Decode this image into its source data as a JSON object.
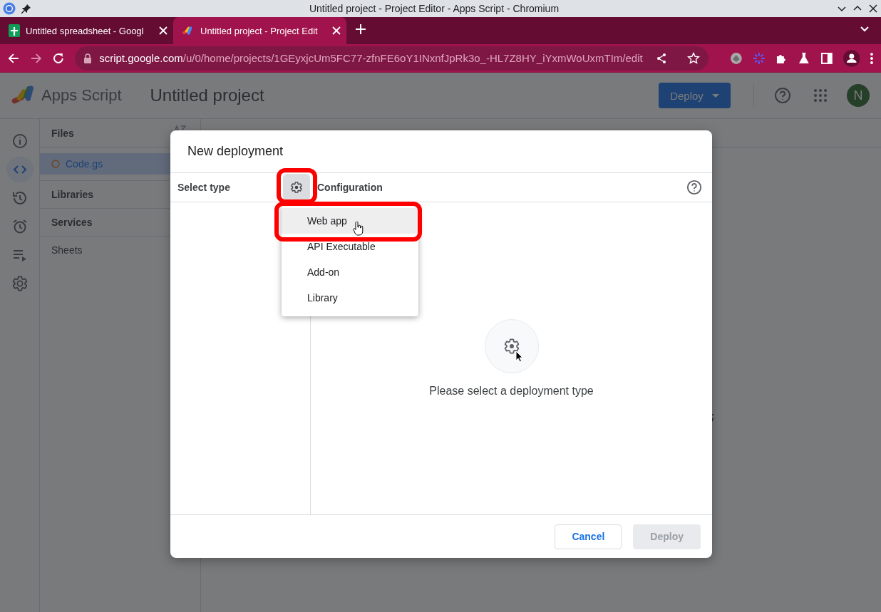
{
  "window": {
    "title": "Untitled project - Project Editor - Apps Script - Chromium"
  },
  "tabs": [
    {
      "label": "Untitled spreadsheet - Googl",
      "selected": false,
      "kind": "sheets"
    },
    {
      "label": "Untitled project - Project Edit",
      "selected": true,
      "kind": "script"
    }
  ],
  "address_bar": {
    "host": "script.google.com",
    "path": "/u/0/home/projects/1GEyxjcUm5FC77-zfnFE6oY1INxnfJpRk3o_-HL7Z8HY_iYxmWoUxmTIm/edit"
  },
  "app": {
    "name": "Apps Script",
    "project": "Untitled project",
    "deploy_button": "Deploy",
    "avatar": "N"
  },
  "rail": [
    {
      "kind": "info",
      "selected": false
    },
    {
      "kind": "code",
      "selected": true
    },
    {
      "kind": "history",
      "selected": false
    },
    {
      "kind": "triggers",
      "selected": false
    },
    {
      "kind": "executions",
      "selected": false
    },
    {
      "kind": "settings",
      "selected": false
    }
  ],
  "files_panel": {
    "title": "Files",
    "files": [
      {
        "name": "Code.gs",
        "selected": true
      }
    ],
    "sections": [
      "Libraries",
      "Services",
      "Sheets"
    ]
  },
  "editor": {
    "fragment": ";"
  },
  "dialog": {
    "title": "New deployment",
    "select_type": "Select type",
    "configuration": "Configuration",
    "message": "Please select a deployment type",
    "buttons": [
      {
        "label": "Cancel",
        "disabled": false
      },
      {
        "label": "Deploy",
        "disabled": true
      }
    ]
  },
  "type_menu": {
    "items": [
      {
        "label": "Web app",
        "selected": true
      },
      {
        "label": "API Executable",
        "selected": false
      },
      {
        "label": "Add-on",
        "selected": false
      },
      {
        "label": "Library",
        "selected": false
      }
    ]
  }
}
